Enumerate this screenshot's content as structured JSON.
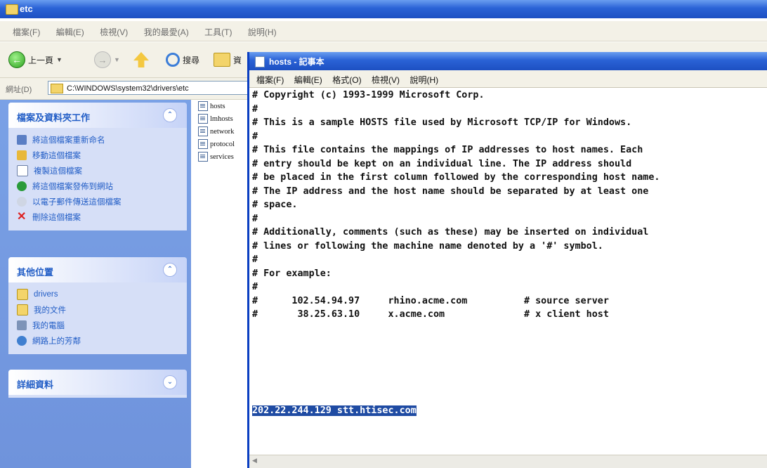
{
  "explorer": {
    "title": "etc",
    "menu": [
      "檔案(F)",
      "編輯(E)",
      "檢視(V)",
      "我的最愛(A)",
      "工具(T)",
      "說明(H)"
    ],
    "toolbar": {
      "back": "上一頁",
      "search": "搜尋",
      "folders": "資"
    },
    "address_label": "網址(D)",
    "address_value": "C:\\WINDOWS\\system32\\drivers\\etc",
    "panels": {
      "file_tasks": {
        "title": "檔案及資料夾工作",
        "items": [
          "將這個檔案重新命名",
          "移動這個檔案",
          "複製這個檔案",
          "將這個檔案發佈到網站",
          "以電子郵件傳送這個檔案",
          "刪除這個檔案"
        ]
      },
      "other_places": {
        "title": "其他位置",
        "items": [
          "drivers",
          "我的文件",
          "我的電腦",
          "網路上的芳鄰"
        ]
      },
      "details": {
        "title": "詳細資料"
      }
    },
    "files": [
      "hosts",
      "lmhosts",
      "network",
      "protocol",
      "services"
    ]
  },
  "notepad": {
    "title": "hosts - 記事本",
    "menu": [
      "檔案(F)",
      "編輯(E)",
      "格式(O)",
      "檢視(V)",
      "說明(H)"
    ],
    "lines": [
      "# Copyright (c) 1993-1999 Microsoft Corp.",
      "#",
      "# This is a sample HOSTS file used by Microsoft TCP/IP for Windows.",
      "#",
      "# This file contains the mappings of IP addresses to host names. Each",
      "# entry should be kept on an individual line. The IP address should",
      "# be placed in the first column followed by the corresponding host name.",
      "# The IP address and the host name should be separated by at least one",
      "# space.",
      "#",
      "# Additionally, comments (such as these) may be inserted on individual",
      "# lines or following the machine name denoted by a '#' symbol.",
      "#",
      "# For example:",
      "#",
      "#      102.54.94.97     rhino.acme.com          # source server",
      "#       38.25.63.10     x.acme.com              # x client host",
      "",
      "",
      "",
      "",
      "",
      ""
    ],
    "selected_line": "202.22.244.129 stt.htisec.com"
  }
}
